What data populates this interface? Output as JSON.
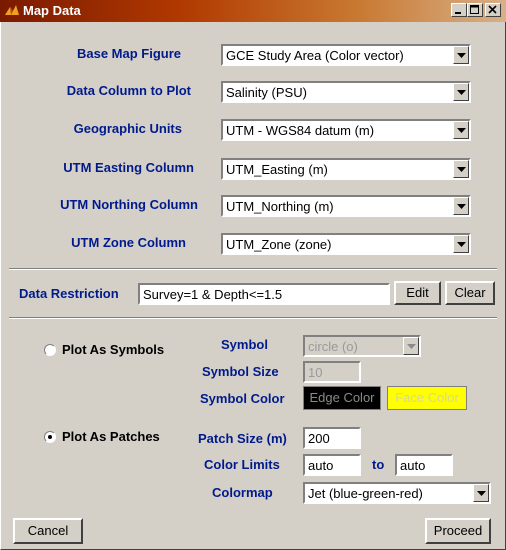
{
  "window": {
    "title": "Map Data",
    "icon": "matlab-icon",
    "controls": [
      "minimize-icon",
      "maximize-icon",
      "close-icon"
    ]
  },
  "fields": {
    "base_map": {
      "label": "Base Map Figure",
      "value": "GCE Study Area (Color vector)"
    },
    "data_column": {
      "label": "Data Column to Plot",
      "value": "Salinity (PSU)"
    },
    "geo_units": {
      "label": "Geographic Units",
      "value": "UTM - WGS84 datum (m)"
    },
    "easting": {
      "label": "UTM Easting Column",
      "value": "UTM_Easting (m)"
    },
    "northing": {
      "label": "UTM Northing Column",
      "value": "UTM_Northing (m)"
    },
    "zone": {
      "label": "UTM Zone Column",
      "value": "UTM_Zone (zone)"
    }
  },
  "restriction": {
    "label": "Data Restriction",
    "value": "Survey=1 & Depth<=1.5",
    "edit_label": "Edit",
    "clear_label": "Clear"
  },
  "symbols": {
    "radio_label": "Plot As Symbols",
    "selected": false,
    "symbol_label": "Symbol",
    "symbol_value": "circle (o)",
    "size_label": "Symbol Size",
    "size_value": "10",
    "color_label": "Symbol Color",
    "edge_label": "Edge Color",
    "face_label": "Face Color",
    "edge_color": "#000000",
    "face_color": "#ffff00"
  },
  "patches": {
    "radio_label": "Plot As Patches",
    "selected": true,
    "patch_size_label": "Patch Size (m)",
    "patch_size_value": "200",
    "limits_label": "Color Limits",
    "limit_min": "auto",
    "to_label": "to",
    "limit_max": "auto",
    "colormap_label": "Colormap",
    "colormap_value": "Jet (blue-green-red)"
  },
  "footer": {
    "cancel_label": "Cancel",
    "proceed_label": "Proceed"
  }
}
